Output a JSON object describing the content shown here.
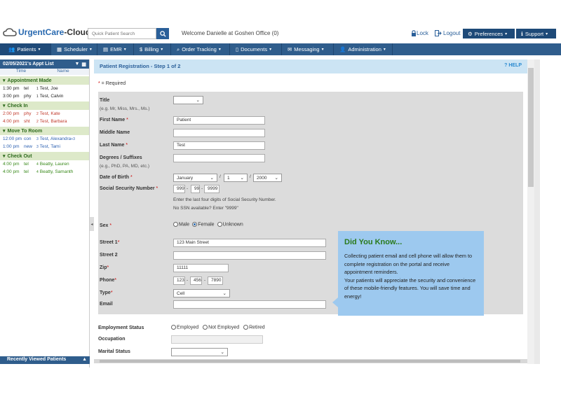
{
  "header": {
    "logo_urgent": "UrgentCare",
    "logo_cloud": "-Cloud",
    "search_placeholder": "Quick Patient Search",
    "welcome_prefix": "Welcome Danielle at Goshen Office ",
    "welcome_count": "(0)",
    "lock": "Lock",
    "logout": "Logout",
    "preferences": "Preferences",
    "support": "Support"
  },
  "nav": {
    "items": [
      {
        "label": "Patients",
        "icon": "users-icon"
      },
      {
        "label": "Scheduler",
        "icon": "calendar-icon"
      },
      {
        "label": "EMR",
        "icon": "emr-icon"
      },
      {
        "label": "Billing",
        "icon": "dollar-icon"
      },
      {
        "label": "Order Tracking",
        "icon": "search-icon"
      },
      {
        "label": "Documents",
        "icon": "document-icon"
      },
      {
        "label": "Messaging",
        "icon": "envelope-icon"
      },
      {
        "label": "Administration",
        "icon": "user-icon"
      }
    ]
  },
  "appt_list": {
    "title": "02/05/2021's Appt List",
    "col_time": "Time",
    "col_name": "Name",
    "groups": [
      {
        "label": "Appointment Made",
        "rows": [
          {
            "time": "1:30 pm",
            "type": "tel",
            "sup": "1",
            "name": "Test, Joe"
          },
          {
            "time": "3:00 pm",
            "type": "phy",
            "sup": "1",
            "name": "Test, Calvin"
          }
        ]
      },
      {
        "label": "Check In",
        "rows": [
          {
            "time": "2:00 pm",
            "type": "phy",
            "sup": "2",
            "name": "Test, Kate"
          },
          {
            "time": "4:00 pm",
            "type": "sht",
            "sup": "2",
            "name": "Test, Barbara"
          }
        ]
      },
      {
        "label": "Move To Room",
        "rows": [
          {
            "time": "12:00 pm",
            "type": "con",
            "sup": "3",
            "name": "Test, Alexandra",
            "extra": "+3"
          },
          {
            "time": "1:00 pm",
            "type": "new",
            "sup": "3",
            "name": "Test, Tami"
          }
        ]
      },
      {
        "label": "Check Out",
        "rows": [
          {
            "time": "4:00 pm",
            "type": "tel",
            "sup": "4",
            "name": "Beatty, Lauren"
          },
          {
            "time": "4:00 pm",
            "type": "tel",
            "sup": "4",
            "name": "Beatty, Samanth"
          }
        ]
      }
    ],
    "recent": "Recently Viewed Patients"
  },
  "form": {
    "title": "Patient Registration - Step 1 of 2",
    "help": "HELP",
    "required_star": "*",
    "required_text": " = Required",
    "title_label": "Title",
    "title_sub": "(e.g. Mr, Miss, Mrs., Ms.)",
    "first_name_label": "First Name",
    "first_name": "Patient",
    "middle_name_label": "Middle Name",
    "last_name_label": "Last Name",
    "last_name": "Test",
    "degrees_label": "Degrees / Suffixes",
    "degrees_sub": "(e.g., PhD, PA, MD, etc.)",
    "dob_label": "Date of Birth",
    "dob_month": "January",
    "dob_day": "1",
    "dob_year": "2000",
    "slash": "/",
    "ssn_label": "Social Security Number",
    "ssn1": "999",
    "ssn2": "99",
    "ssn3": "9999",
    "dash": "-",
    "ssn_note1": "Enter the last four digits of Social Security Number.",
    "ssn_note2": "No SSN available? Enter \"9999\"",
    "sex_label": "Sex",
    "sex_male": "Male",
    "sex_female": "Female",
    "sex_unknown": "Unknown",
    "street1_label": "Street 1",
    "street1": "123 Main Street",
    "street2_label": "Street 2",
    "zip_label": "Zip",
    "zip": "11111",
    "phone_label": "Phone",
    "phone1": "123",
    "phone2": "456",
    "phone3": "7890",
    "type_label": "Type",
    "type_value": "Cell",
    "email_label": "Email",
    "employment_label": "Employment Status",
    "emp_employed": "Employed",
    "emp_not": "Not Employed",
    "emp_retired": "Retired",
    "occupation_label": "Occupation",
    "marital_label": "Marital Status"
  },
  "tip": {
    "title": "Did You Know...",
    "body1": "Collecting patient email and cell phone will allow them to complete registration on the portal and receive appointment reminders.",
    "body2": "Your patients will appreciate the security and convenience of these mobile-friendly features. You will save time and energy!"
  }
}
